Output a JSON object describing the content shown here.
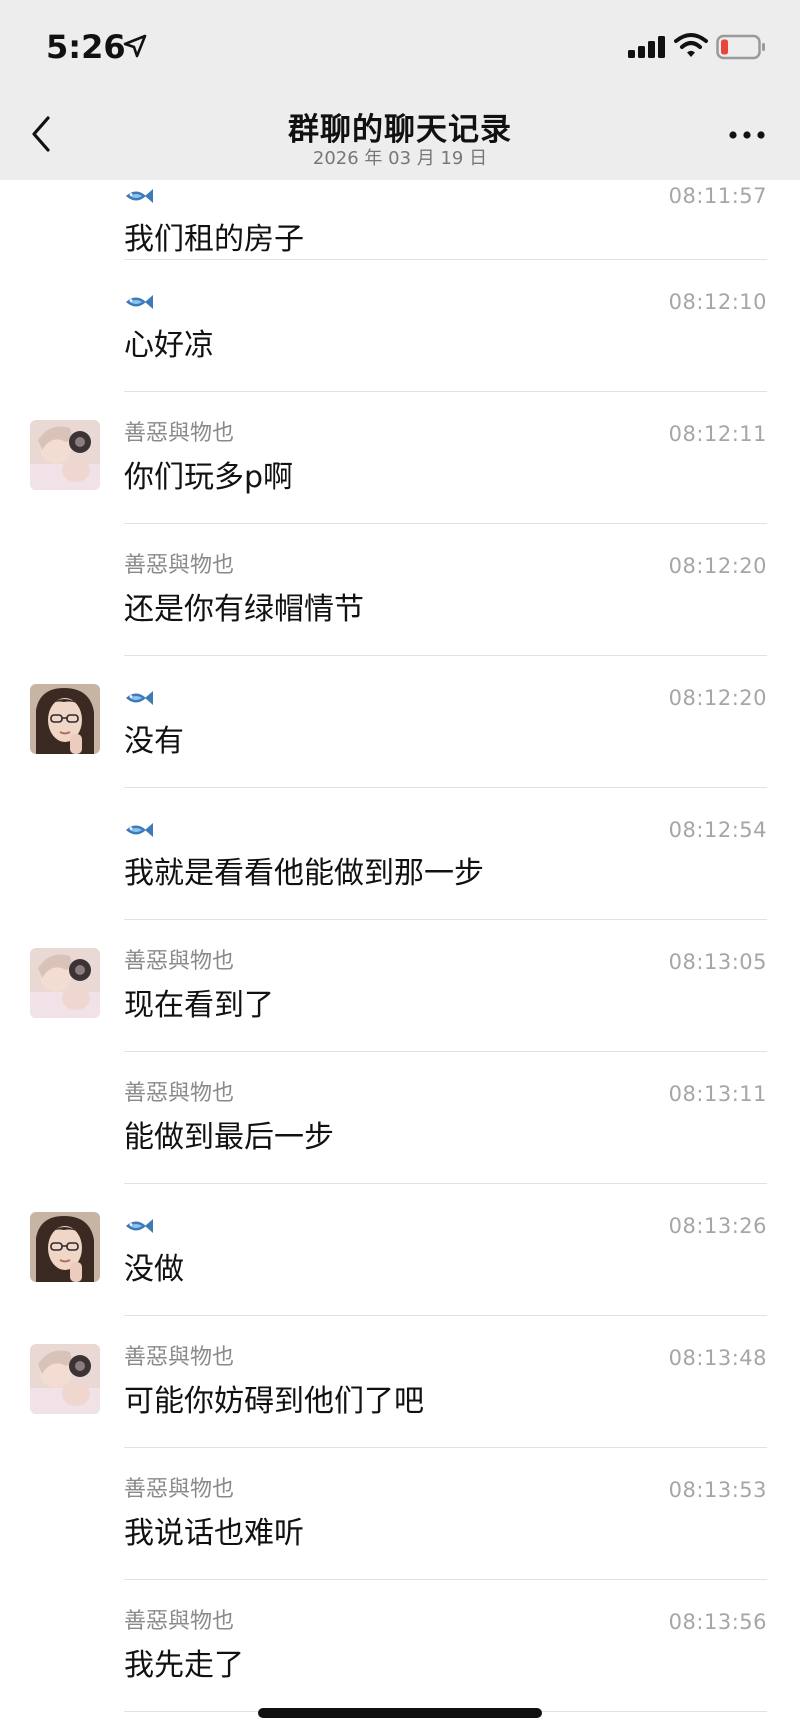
{
  "status_bar": {
    "time": "5:26"
  },
  "nav": {
    "title": "群聊的聊天记录",
    "subtitle": "2026 年 03 月 19 日"
  },
  "messages": [
    {
      "sender": "",
      "sender_icon": "fish-icon",
      "time": "08:11:57",
      "text": "我们租的房子",
      "avatar": "none"
    },
    {
      "sender": "",
      "sender_icon": "fish-icon",
      "time": "08:12:10",
      "text": "心好凉",
      "avatar": "none"
    },
    {
      "sender": "善惡與物也",
      "time": "08:12:11",
      "text": "你们玩多p啊",
      "avatar": "girl-light-avatar"
    },
    {
      "sender": "善惡與物也",
      "time": "08:12:20",
      "text": "还是你有绿帽情节",
      "avatar": "none"
    },
    {
      "sender": "",
      "sender_icon": "fish-icon",
      "time": "08:12:20",
      "text": "没有",
      "avatar": "girl-glasses-avatar"
    },
    {
      "sender": "",
      "sender_icon": "fish-icon",
      "time": "08:12:54",
      "text": "我就是看看他能做到那一步",
      "avatar": "none"
    },
    {
      "sender": "善惡與物也",
      "time": "08:13:05",
      "text": "现在看到了",
      "avatar": "girl-light-avatar"
    },
    {
      "sender": "善惡與物也",
      "time": "08:13:11",
      "text": "能做到最后一步",
      "avatar": "none"
    },
    {
      "sender": "",
      "sender_icon": "fish-icon",
      "time": "08:13:26",
      "text": "没做",
      "avatar": "girl-glasses-avatar"
    },
    {
      "sender": "善惡與物也",
      "time": "08:13:48",
      "text": "可能你妨碍到他们了吧",
      "avatar": "girl-light-avatar"
    },
    {
      "sender": "善惡與物也",
      "time": "08:13:53",
      "text": "我说话也难听",
      "avatar": "none"
    },
    {
      "sender": "善惡與物也",
      "time": "08:13:56",
      "text": "我先走了",
      "avatar": "none"
    }
  ],
  "colors": {
    "topbar_bg": "#ededed",
    "timestamp": "#a6a6a6",
    "sender": "#8a8a8a",
    "divider": "#e2e2e2",
    "fish": "#3f7ab8",
    "battery_low": "#e8453c"
  }
}
